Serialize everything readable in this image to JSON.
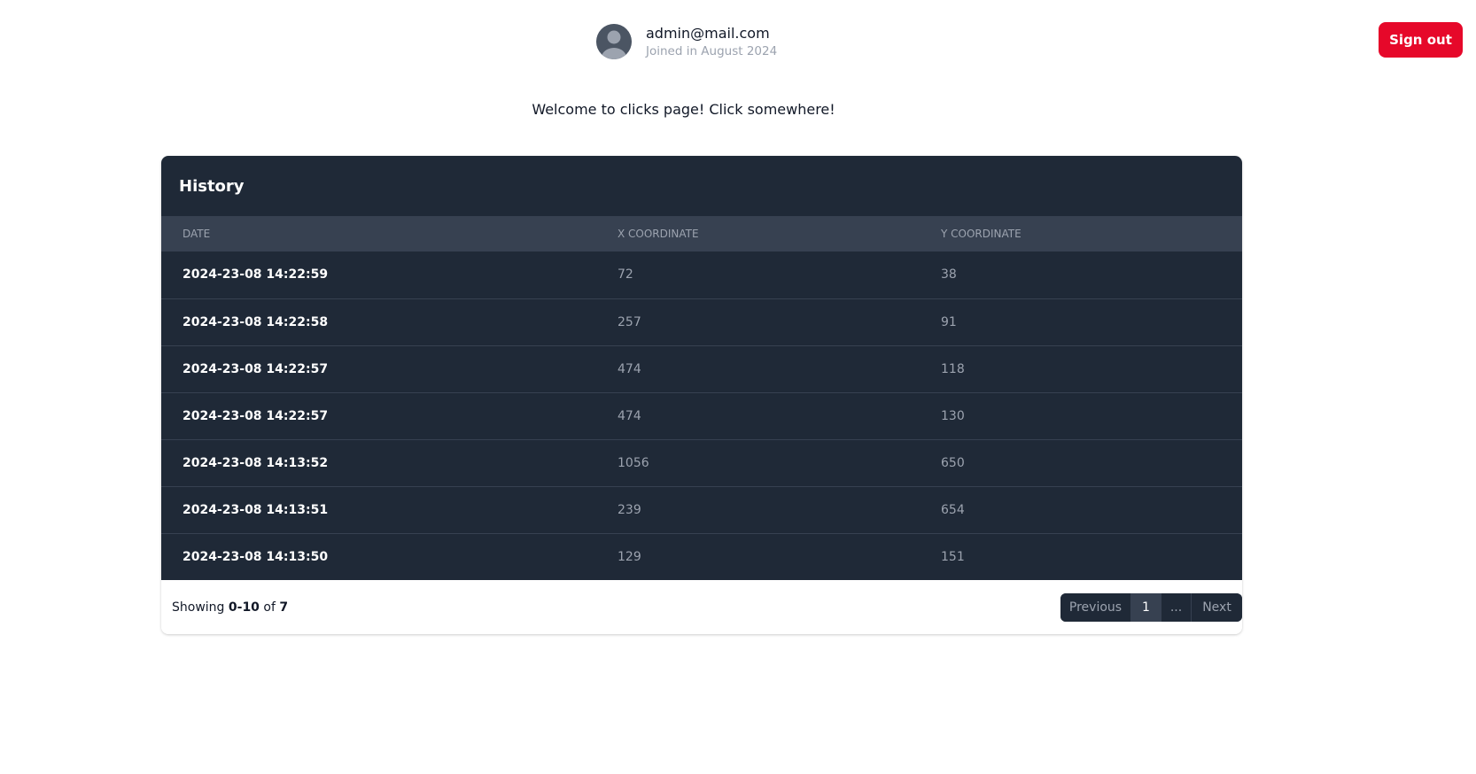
{
  "user": {
    "email": "admin@mail.com",
    "joined": "Joined in August 2024",
    "avatar_icon": "user-avatar-icon"
  },
  "header": {
    "signout_label": "Sign out",
    "signout_color": "#e6082a"
  },
  "welcome_text": "Welcome to clicks page! Click somewhere!",
  "history": {
    "title": "History",
    "columns": [
      "Date",
      "X coordinate",
      "Y coordinate"
    ],
    "rows": [
      {
        "date": "2024-23-08 14:22:59",
        "x": "72",
        "y": "38"
      },
      {
        "date": "2024-23-08 14:22:58",
        "x": "257",
        "y": "91"
      },
      {
        "date": "2024-23-08 14:22:57",
        "x": "474",
        "y": "118"
      },
      {
        "date": "2024-23-08 14:22:57",
        "x": "474",
        "y": "130"
      },
      {
        "date": "2024-23-08 14:13:52",
        "x": "1056",
        "y": "650"
      },
      {
        "date": "2024-23-08 14:13:51",
        "x": "239",
        "y": "654"
      },
      {
        "date": "2024-23-08 14:13:50",
        "x": "129",
        "y": "151"
      }
    ]
  },
  "footer": {
    "showing_prefix": "Showing",
    "showing_range": "0-10",
    "showing_of": "of",
    "showing_total": "7"
  },
  "pagination": {
    "previous_label": "Previous",
    "current_page": "1",
    "ellipsis": "...",
    "next_label": "Next"
  }
}
